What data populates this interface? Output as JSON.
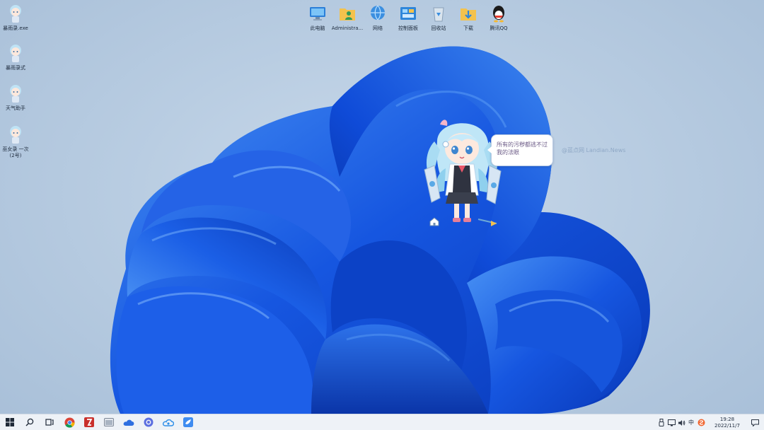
{
  "desktop": {
    "left_icons": [
      {
        "label": "暴雨录.exe",
        "icon": "anime-girl-icon"
      },
      {
        "label": "暴雨录式",
        "icon": "anime-girl-icon"
      },
      {
        "label": "天气助手",
        "icon": "anime-girl-icon"
      },
      {
        "label": "巫女录 一次\n(2号)",
        "icon": "anime-girl-icon"
      }
    ],
    "top_icons": [
      {
        "label": "此电脑",
        "icon": "computer-icon"
      },
      {
        "label": "Administra...",
        "icon": "user-folder-icon"
      },
      {
        "label": "网络",
        "icon": "network-icon"
      },
      {
        "label": "控制面板",
        "icon": "control-panel-icon"
      },
      {
        "label": "回收站",
        "icon": "recycle-bin-icon"
      },
      {
        "label": "下载",
        "icon": "download-folder-icon"
      },
      {
        "label": "腾讯QQ",
        "icon": "qq-penguin-icon"
      }
    ]
  },
  "pet": {
    "bubble_text": "所有的污秽都逃不过我的法眼"
  },
  "watermark": "@蓝点网 Landian.News",
  "taskbar": {
    "buttons": [
      {
        "name": "start-button",
        "icon": "windows-logo-icon"
      },
      {
        "name": "search-button",
        "icon": "search-icon"
      },
      {
        "name": "task-view-button",
        "icon": "task-view-icon"
      },
      {
        "name": "chrome-button",
        "icon": "chrome-icon"
      },
      {
        "name": "filezilla-button",
        "icon": "filezilla-icon"
      },
      {
        "name": "app-window-button",
        "icon": "window-app-icon"
      },
      {
        "name": "cloud-drive-button",
        "icon": "cloud-drive-icon"
      },
      {
        "name": "circle-app-button",
        "icon": "circle-app-icon"
      },
      {
        "name": "baidu-netdisk-button",
        "icon": "netdisk-icon"
      },
      {
        "name": "bird-app-button",
        "icon": "bird-app-icon"
      }
    ],
    "tray": {
      "ime_label": "中",
      "time": "19:28",
      "date": "2022/11/7"
    }
  },
  "colors": {
    "wallpaper_deep": "#0a3fc4",
    "wallpaper_light": "#3f8cf0",
    "taskbar_bg": "#eef2f7",
    "accent": "#1a73e8"
  }
}
